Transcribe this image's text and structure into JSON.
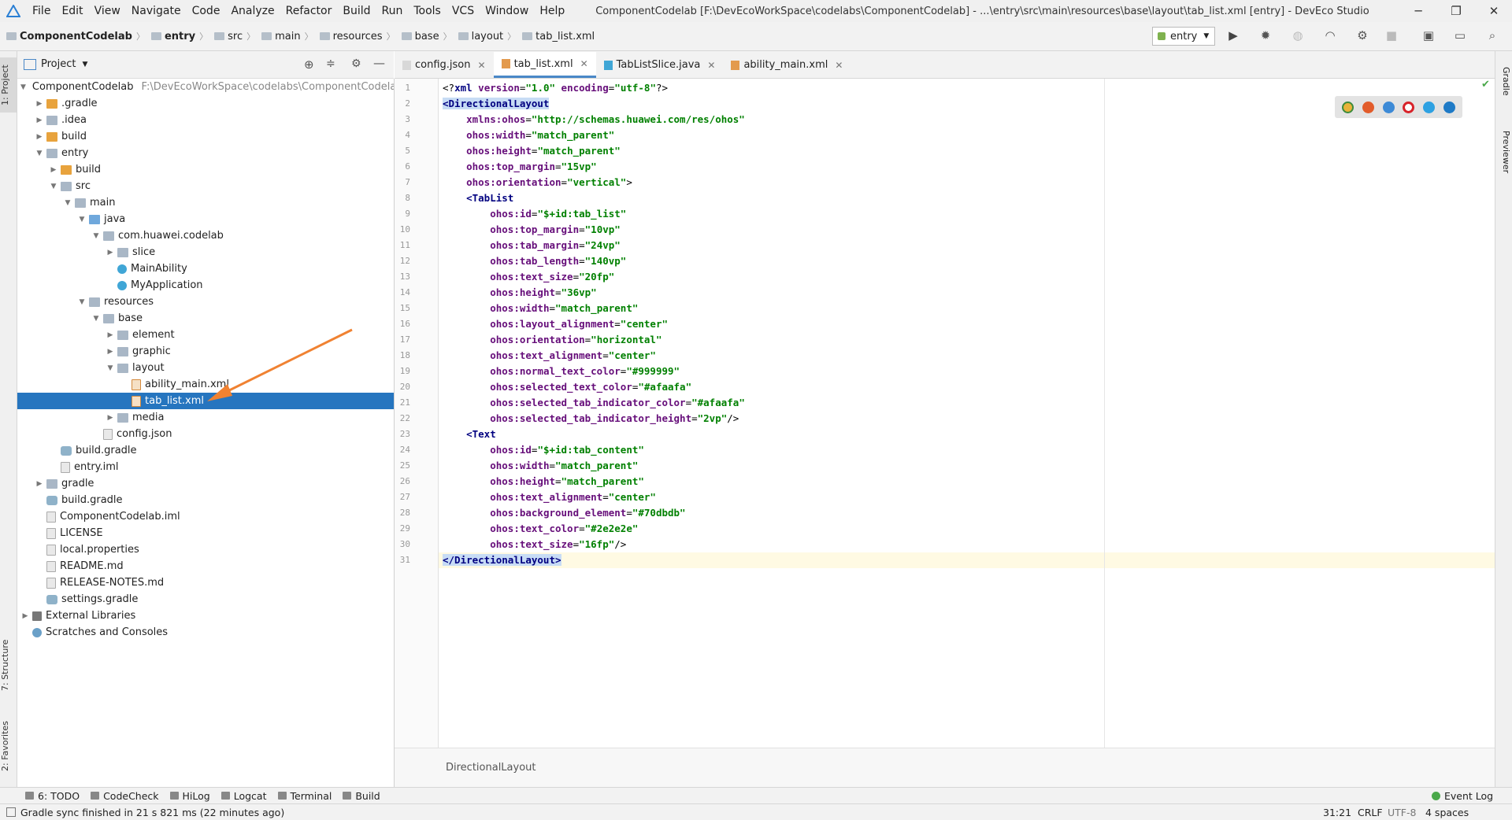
{
  "menubar": {
    "items": [
      "File",
      "Edit",
      "View",
      "Navigate",
      "Code",
      "Analyze",
      "Refactor",
      "Build",
      "Run",
      "Tools",
      "VCS",
      "Window",
      "Help"
    ],
    "title": "ComponentCodelab [F:\\DevEcoWorkSpace\\codelabs\\ComponentCodelab] - ...\\entry\\src\\main\\resources\\base\\layout\\tab_list.xml [entry] - DevEco Studio"
  },
  "breadcrumbs": [
    "ComponentCodelab",
    "entry",
    "src",
    "main",
    "resources",
    "base",
    "layout",
    "tab_list.xml"
  ],
  "run_config": "entry",
  "left_stripe": {
    "project": "1: Project",
    "structure": "7: Structure",
    "favorites": "2: Favorites"
  },
  "right_stripe": {
    "gradle": "Gradle",
    "previewer": "Previewer"
  },
  "project_panel": {
    "title": "Project",
    "root_path": "F:\\DevEcoWorkSpace\\codelabs\\ComponentCodelab",
    "tree": [
      {
        "label": "ComponentCodelab",
        "depth": 0,
        "arrow": "▼",
        "icon": "folder-gray"
      },
      {
        "label": ".gradle",
        "depth": 1,
        "arrow": "▶",
        "icon": "folder-orange"
      },
      {
        "label": ".idea",
        "depth": 1,
        "arrow": "▶",
        "icon": "folder-gray"
      },
      {
        "label": "build",
        "depth": 1,
        "arrow": "▶",
        "icon": "folder-orange"
      },
      {
        "label": "entry",
        "depth": 1,
        "arrow": "▼",
        "icon": "folder-gray"
      },
      {
        "label": "build",
        "depth": 2,
        "arrow": "▶",
        "icon": "folder-orange"
      },
      {
        "label": "src",
        "depth": 2,
        "arrow": "▼",
        "icon": "folder-gray"
      },
      {
        "label": "main",
        "depth": 3,
        "arrow": "▼",
        "icon": "folder-gray"
      },
      {
        "label": "java",
        "depth": 4,
        "arrow": "▼",
        "icon": "folder-blue"
      },
      {
        "label": "com.huawei.codelab",
        "depth": 5,
        "arrow": "▼",
        "icon": "folder-gray"
      },
      {
        "label": "slice",
        "depth": 6,
        "arrow": "▶",
        "icon": "folder-gray"
      },
      {
        "label": "MainAbility",
        "depth": 6,
        "arrow": "",
        "icon": "java-class"
      },
      {
        "label": "MyApplication",
        "depth": 6,
        "arrow": "",
        "icon": "java-class"
      },
      {
        "label": "resources",
        "depth": 4,
        "arrow": "▼",
        "icon": "folder-gray"
      },
      {
        "label": "base",
        "depth": 5,
        "arrow": "▼",
        "icon": "folder-gray"
      },
      {
        "label": "element",
        "depth": 6,
        "arrow": "▶",
        "icon": "folder-gray"
      },
      {
        "label": "graphic",
        "depth": 6,
        "arrow": "▶",
        "icon": "folder-gray"
      },
      {
        "label": "layout",
        "depth": 6,
        "arrow": "▼",
        "icon": "folder-gray"
      },
      {
        "label": "ability_main.xml",
        "depth": 7,
        "arrow": "",
        "icon": "xml"
      },
      {
        "label": "tab_list.xml",
        "depth": 7,
        "arrow": "",
        "icon": "xml",
        "selected": true
      },
      {
        "label": "media",
        "depth": 6,
        "arrow": "▶",
        "icon": "folder-gray"
      },
      {
        "label": "config.json",
        "depth": 5,
        "arrow": "",
        "icon": "file"
      },
      {
        "label": "build.gradle",
        "depth": 2,
        "arrow": "",
        "icon": "gradle"
      },
      {
        "label": "entry.iml",
        "depth": 2,
        "arrow": "",
        "icon": "file"
      },
      {
        "label": "gradle",
        "depth": 1,
        "arrow": "▶",
        "icon": "folder-gray"
      },
      {
        "label": "build.gradle",
        "depth": 1,
        "arrow": "",
        "icon": "gradle"
      },
      {
        "label": "ComponentCodelab.iml",
        "depth": 1,
        "arrow": "",
        "icon": "file"
      },
      {
        "label": "LICENSE",
        "depth": 1,
        "arrow": "",
        "icon": "file"
      },
      {
        "label": "local.properties",
        "depth": 1,
        "arrow": "",
        "icon": "file"
      },
      {
        "label": "README.md",
        "depth": 1,
        "arrow": "",
        "icon": "file"
      },
      {
        "label": "RELEASE-NOTES.md",
        "depth": 1,
        "arrow": "",
        "icon": "file"
      },
      {
        "label": "settings.gradle",
        "depth": 1,
        "arrow": "",
        "icon": "gradle"
      },
      {
        "label": "External Libraries",
        "depth": 0,
        "arrow": "▶",
        "icon": "lib"
      },
      {
        "label": "Scratches and Consoles",
        "depth": 0,
        "arrow": "",
        "icon": "scratch"
      }
    ]
  },
  "editor": {
    "tabs": [
      {
        "label": "config.json",
        "icon": "json-file-icon",
        "active": false
      },
      {
        "label": "tab_list.xml",
        "icon": "xml-file-icon",
        "active": true
      },
      {
        "label": "TabListSlice.java",
        "icon": "java-class-icon",
        "active": false
      },
      {
        "label": "ability_main.xml",
        "icon": "xml-file-icon",
        "active": false
      }
    ],
    "lines": [
      [
        [
          "plain",
          "<?"
        ],
        [
          "tag",
          "xml "
        ],
        [
          "attr",
          "version"
        ],
        [
          "plain",
          "="
        ],
        [
          "val",
          "\"1.0\" "
        ],
        [
          "attr",
          "encoding"
        ],
        [
          "plain",
          "="
        ],
        [
          "val",
          "\"utf-8\""
        ],
        [
          "plain",
          "?>"
        ]
      ],
      [
        [
          "hl",
          "<DirectionalLayout"
        ]
      ],
      [
        [
          "plain",
          "    "
        ],
        [
          "attr",
          "xmlns:ohos"
        ],
        [
          "plain",
          "="
        ],
        [
          "val",
          "\"http://schemas.huawei.com/res/ohos\""
        ]
      ],
      [
        [
          "plain",
          "    "
        ],
        [
          "attr",
          "ohos:width"
        ],
        [
          "plain",
          "="
        ],
        [
          "val",
          "\"match_parent\""
        ]
      ],
      [
        [
          "plain",
          "    "
        ],
        [
          "attr",
          "ohos:height"
        ],
        [
          "plain",
          "="
        ],
        [
          "val",
          "\"match_parent\""
        ]
      ],
      [
        [
          "plain",
          "    "
        ],
        [
          "attr",
          "ohos:top_margin"
        ],
        [
          "plain",
          "="
        ],
        [
          "val",
          "\"15vp\""
        ]
      ],
      [
        [
          "plain",
          "    "
        ],
        [
          "attr",
          "ohos:orientation"
        ],
        [
          "plain",
          "="
        ],
        [
          "val",
          "\"vertical\""
        ],
        [
          "plain",
          ">"
        ]
      ],
      [
        [
          "plain",
          "    "
        ],
        [
          "tag",
          "<TabList"
        ]
      ],
      [
        [
          "plain",
          "        "
        ],
        [
          "attr",
          "ohos:id"
        ],
        [
          "plain",
          "="
        ],
        [
          "val",
          "\"$+id:tab_list\""
        ]
      ],
      [
        [
          "plain",
          "        "
        ],
        [
          "attr",
          "ohos:top_margin"
        ],
        [
          "plain",
          "="
        ],
        [
          "val",
          "\"10vp\""
        ]
      ],
      [
        [
          "plain",
          "        "
        ],
        [
          "attr",
          "ohos:tab_margin"
        ],
        [
          "plain",
          "="
        ],
        [
          "val",
          "\"24vp\""
        ]
      ],
      [
        [
          "plain",
          "        "
        ],
        [
          "attr",
          "ohos:tab_length"
        ],
        [
          "plain",
          "="
        ],
        [
          "val",
          "\"140vp\""
        ]
      ],
      [
        [
          "plain",
          "        "
        ],
        [
          "attr",
          "ohos:text_size"
        ],
        [
          "plain",
          "="
        ],
        [
          "val",
          "\"20fp\""
        ]
      ],
      [
        [
          "plain",
          "        "
        ],
        [
          "attr",
          "ohos:height"
        ],
        [
          "plain",
          "="
        ],
        [
          "val",
          "\"36vp\""
        ]
      ],
      [
        [
          "plain",
          "        "
        ],
        [
          "attr",
          "ohos:width"
        ],
        [
          "plain",
          "="
        ],
        [
          "val",
          "\"match_parent\""
        ]
      ],
      [
        [
          "plain",
          "        "
        ],
        [
          "attr",
          "ohos:layout_alignment"
        ],
        [
          "plain",
          "="
        ],
        [
          "val",
          "\"center\""
        ]
      ],
      [
        [
          "plain",
          "        "
        ],
        [
          "attr",
          "ohos:orientation"
        ],
        [
          "plain",
          "="
        ],
        [
          "val",
          "\"horizontal\""
        ]
      ],
      [
        [
          "plain",
          "        "
        ],
        [
          "attr",
          "ohos:text_alignment"
        ],
        [
          "plain",
          "="
        ],
        [
          "val",
          "\"center\""
        ]
      ],
      [
        [
          "plain",
          "        "
        ],
        [
          "attr",
          "ohos:normal_text_color"
        ],
        [
          "plain",
          "="
        ],
        [
          "val",
          "\"#999999\""
        ]
      ],
      [
        [
          "plain",
          "        "
        ],
        [
          "attr",
          "ohos:selected_text_color"
        ],
        [
          "plain",
          "="
        ],
        [
          "val",
          "\"#afaafa\""
        ]
      ],
      [
        [
          "plain",
          "        "
        ],
        [
          "attr",
          "ohos:selected_tab_indicator_color"
        ],
        [
          "plain",
          "="
        ],
        [
          "val",
          "\"#afaafa\""
        ]
      ],
      [
        [
          "plain",
          "        "
        ],
        [
          "attr",
          "ohos:selected_tab_indicator_height"
        ],
        [
          "plain",
          "="
        ],
        [
          "val",
          "\"2vp\""
        ],
        [
          "plain",
          "/>"
        ]
      ],
      [
        [
          "plain",
          "    "
        ],
        [
          "tag",
          "<Text"
        ]
      ],
      [
        [
          "plain",
          "        "
        ],
        [
          "attr",
          "ohos:id"
        ],
        [
          "plain",
          "="
        ],
        [
          "val",
          "\"$+id:tab_content\""
        ]
      ],
      [
        [
          "plain",
          "        "
        ],
        [
          "attr",
          "ohos:width"
        ],
        [
          "plain",
          "="
        ],
        [
          "val",
          "\"match_parent\""
        ]
      ],
      [
        [
          "plain",
          "        "
        ],
        [
          "attr",
          "ohos:height"
        ],
        [
          "plain",
          "="
        ],
        [
          "val",
          "\"match_parent\""
        ]
      ],
      [
        [
          "plain",
          "        "
        ],
        [
          "attr",
          "ohos:text_alignment"
        ],
        [
          "plain",
          "="
        ],
        [
          "val",
          "\"center\""
        ]
      ],
      [
        [
          "plain",
          "        "
        ],
        [
          "attr",
          "ohos:background_element"
        ],
        [
          "plain",
          "="
        ],
        [
          "val",
          "\"#70dbdb\""
        ]
      ],
      [
        [
          "plain",
          "        "
        ],
        [
          "attr",
          "ohos:text_color"
        ],
        [
          "plain",
          "="
        ],
        [
          "val",
          "\"#2e2e2e\""
        ]
      ],
      [
        [
          "plain",
          "        "
        ],
        [
          "attr",
          "ohos:text_size"
        ],
        [
          "plain",
          "="
        ],
        [
          "val",
          "\"16fp\""
        ],
        [
          "plain",
          "/>"
        ]
      ],
      [
        [
          "hl",
          "</DirectionalLayout>"
        ]
      ]
    ],
    "current_line": 31,
    "footer_breadcrumb": "DirectionalLayout"
  },
  "bottom_tools": [
    "6: TODO",
    "CodeCheck",
    "HiLog",
    "Logcat",
    "Terminal",
    "Build"
  ],
  "event_log": "Event Log",
  "status": {
    "message": "Gradle sync finished in 21 s 821 ms (22 minutes ago)",
    "position": "31:21",
    "line_sep": "CRLF",
    "encoding": "UTF-8",
    "indent": "4 spaces"
  },
  "colors": {
    "accent": "#2675bf",
    "arrow": "#f08232",
    "xml_tag": "#000080",
    "xml_attr": "#660e7a",
    "xml_value": "#008000"
  }
}
